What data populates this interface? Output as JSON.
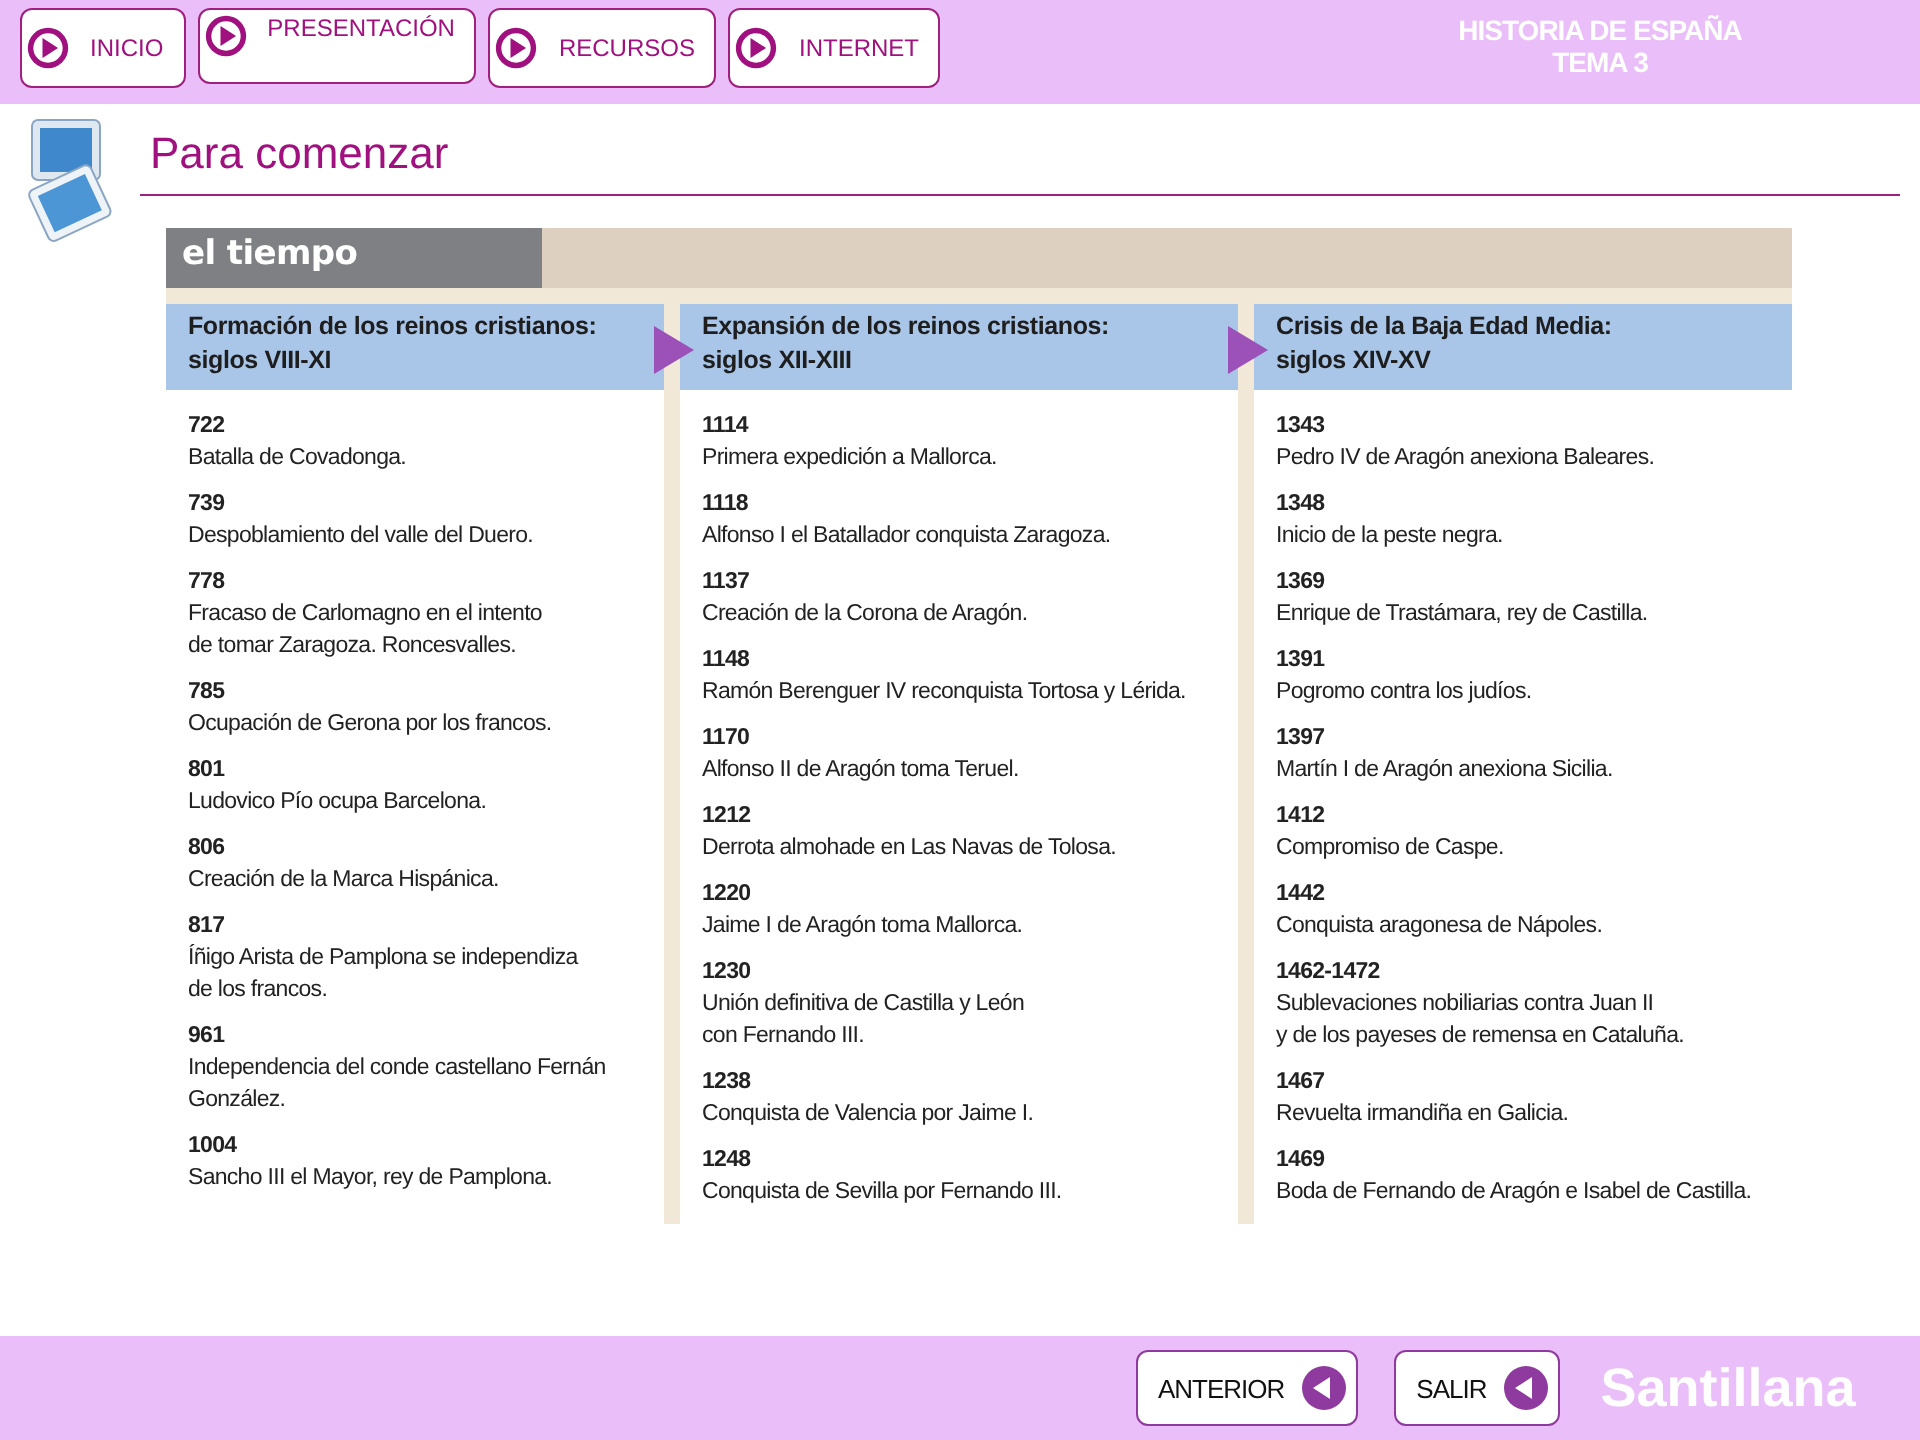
{
  "nav_buttons": [
    "INICIO",
    "PRESENTACIÓN",
    "RECURSOS",
    "INTERNET"
  ],
  "course": {
    "line1": "HISTORIA DE ESPAÑA",
    "line2": "TEMA 3"
  },
  "page_title": "Para comenzar",
  "panel_label": "el tiempo",
  "columns": [
    {
      "title": "Formación de los reinos cristianos:",
      "period": "siglos VIII-XI",
      "events": [
        {
          "year": "722",
          "text": "Batalla de Covadonga."
        },
        {
          "year": "739",
          "text": "Despoblamiento del valle del Duero."
        },
        {
          "year": "778",
          "text": "Fracaso de Carlomagno en el intento\nde tomar Zaragoza. Roncesvalles."
        },
        {
          "year": "785",
          "text": "Ocupación de Gerona por los francos."
        },
        {
          "year": "801",
          "text": "Ludovico Pío ocupa Barcelona."
        },
        {
          "year": "806",
          "text": "Creación de la Marca Hispánica."
        },
        {
          "year": "817",
          "text": "Íñigo Arista de Pamplona se independiza\nde los francos."
        },
        {
          "year": "961",
          "text": "Independencia del conde castellano Fernán\nGonzález."
        },
        {
          "year": "1004",
          "text": "Sancho III el Mayor, rey de Pamplona."
        }
      ]
    },
    {
      "title": "Expansión de los reinos cristianos:",
      "period": "siglos XII-XIII",
      "events": [
        {
          "year": "1114",
          "text": "Primera expedición a Mallorca."
        },
        {
          "year": "1118",
          "text": "Alfonso I el Batallador conquista Zaragoza."
        },
        {
          "year": "1137",
          "text": "Creación de la Corona de Aragón."
        },
        {
          "year": "1148",
          "text": "Ramón Berenguer IV reconquista Tortosa y Lérida."
        },
        {
          "year": "1170",
          "text": "Alfonso II de Aragón toma Teruel."
        },
        {
          "year": "1212",
          "text": "Derrota almohade en Las Navas de Tolosa."
        },
        {
          "year": "1220",
          "text": "Jaime I de Aragón toma Mallorca."
        },
        {
          "year": "1230",
          "text": "Unión definitiva de Castilla y León\ncon Fernando III."
        },
        {
          "year": "1238",
          "text": "Conquista de Valencia por Jaime I."
        },
        {
          "year": "1248",
          "text": "Conquista de Sevilla por Fernando III."
        }
      ]
    },
    {
      "title": "Crisis de la Baja Edad Media:",
      "period": "siglos XIV-XV",
      "events": [
        {
          "year": "1343",
          "text": "Pedro IV de Aragón anexiona Baleares."
        },
        {
          "year": "1348",
          "text": "Inicio de la peste negra."
        },
        {
          "year": "1369",
          "text": "Enrique de Trastámara, rey de Castilla."
        },
        {
          "year": "1391",
          "text": "Pogromo contra los judíos."
        },
        {
          "year": "1397",
          "text": "Martín I de Aragón anexiona Sicilia."
        },
        {
          "year": "1412",
          "text": "Compromiso de Caspe."
        },
        {
          "year": "1442",
          "text": "Conquista aragonesa de Nápoles."
        },
        {
          "year": "1462-1472",
          "text": "Sublevaciones nobiliarias contra Juan II\ny de los payeses de remensa en Cataluña."
        },
        {
          "year": "1467",
          "text": "Revuelta irmandiña en Galicia."
        },
        {
          "year": "1469",
          "text": "Boda de Fernando de Aragón e Isabel de Castilla."
        }
      ]
    }
  ],
  "footer_buttons": [
    "ANTERIOR",
    "SALIR"
  ],
  "brand": "Santillana"
}
